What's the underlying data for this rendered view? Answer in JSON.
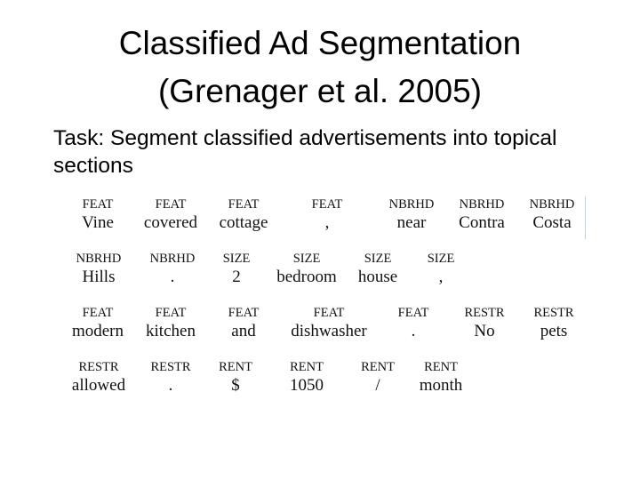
{
  "slide": {
    "title_line1": "Classified Ad Segmentation",
    "title_line2": "(Grenager et al. 2005)",
    "task_text": "Task: Segment classified advertisements into topical sections"
  },
  "segmentation": {
    "rows": [
      [
        {
          "label": "FEAT",
          "word": "Vine"
        },
        {
          "label": "FEAT",
          "word": "covered"
        },
        {
          "label": "FEAT",
          "word": "cottage"
        },
        {
          "label": "FEAT",
          "word": ","
        },
        {
          "label": "NBRHD",
          "word": "near"
        },
        {
          "label": "NBRHD",
          "word": "Contra"
        },
        {
          "label": "NBRHD",
          "word": "Costa"
        }
      ],
      [
        {
          "label": "NBRHD",
          "word": "Hills"
        },
        {
          "label": "NBRHD",
          "word": "."
        },
        {
          "label": "SIZE",
          "word": "2"
        },
        {
          "label": "SIZE",
          "word": "bedroom"
        },
        {
          "label": "SIZE",
          "word": "house"
        },
        {
          "label": "SIZE",
          "word": ","
        }
      ],
      [
        {
          "label": "FEAT",
          "word": "modern"
        },
        {
          "label": "FEAT",
          "word": "kitchen"
        },
        {
          "label": "FEAT",
          "word": "and"
        },
        {
          "label": "FEAT",
          "word": "dishwasher"
        },
        {
          "label": "FEAT",
          "word": "."
        },
        {
          "label": "RESTR",
          "word": "No"
        },
        {
          "label": "RESTR",
          "word": "pets"
        }
      ],
      [
        {
          "label": "RESTR",
          "word": "allowed"
        },
        {
          "label": "RESTR",
          "word": "."
        },
        {
          "label": "RENT",
          "word": "$"
        },
        {
          "label": "RENT",
          "word": "1050"
        },
        {
          "label": "RENT",
          "word": "/"
        },
        {
          "label": "RENT",
          "word": "month"
        }
      ]
    ]
  }
}
